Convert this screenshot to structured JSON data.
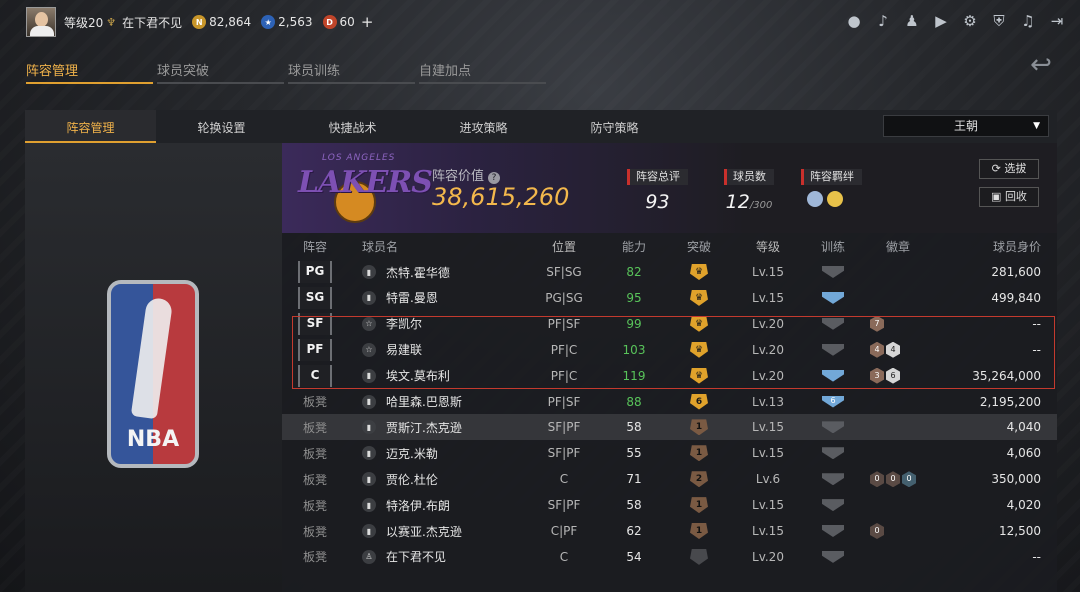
{
  "topbar": {
    "level": "等级20",
    "username": "在下君不见",
    "gold": "82,864",
    "stars": "2,563",
    "tickets": "60",
    "plus": "+"
  },
  "tabs_main": [
    "阵容管理",
    "球员突破",
    "球员训练",
    "自建加点"
  ],
  "tabs_sub": [
    "阵容管理",
    "轮换设置",
    "快捷战术",
    "进攻策略",
    "防守策略"
  ],
  "dynasty_select": "王朝",
  "team": {
    "logo_small": "LOS ANGELES",
    "logo_word": "LAKERS",
    "value_label": "阵容价值",
    "value": "38,615,260",
    "rating_label": "阵容总评",
    "rating": "93",
    "players_label": "球员数",
    "players": "12",
    "players_max": "/300",
    "bond_label": "阵容羁绊",
    "btn_select": "选拔",
    "btn_recycle": "回收"
  },
  "columns": [
    "阵容",
    "球员名",
    "位置",
    "能力",
    "突破",
    "等级",
    "训练",
    "徽章",
    "球员身价"
  ],
  "rows": [
    {
      "slot": "PG",
      "bench": false,
      "name": "杰特.霍华德",
      "pos": "SF|SG",
      "ovr": "82",
      "brk": "",
      "brkType": "gold",
      "lv": "Lv.15",
      "train": "",
      "trainType": "grey",
      "badges": [],
      "price": "281,600",
      "icon": "bars"
    },
    {
      "slot": "SG",
      "bench": false,
      "name": "特雷.曼恩",
      "pos": "PG|SG",
      "ovr": "95",
      "brk": "",
      "brkType": "gold",
      "lv": "Lv.15",
      "train": "",
      "trainType": "blue",
      "badges": [],
      "price": "499,840",
      "icon": "bars"
    },
    {
      "slot": "SF",
      "bench": false,
      "name": "李凯尔",
      "pos": "PF|SF",
      "ovr": "99",
      "brk": "",
      "brkType": "gold",
      "lv": "Lv.20",
      "train": "",
      "trainType": "grey",
      "badges": [
        {
          "t": "7",
          "c": ""
        }
      ],
      "price": "--",
      "icon": "star"
    },
    {
      "slot": "PF",
      "bench": false,
      "name": "易建联",
      "pos": "PF|C",
      "ovr": "103",
      "brk": "",
      "brkType": "gold",
      "lv": "Lv.20",
      "train": "",
      "trainType": "grey",
      "badges": [
        {
          "t": "4",
          "c": ""
        },
        {
          "t": "4",
          "c": "s"
        }
      ],
      "price": "--",
      "icon": "star"
    },
    {
      "slot": "C",
      "bench": false,
      "name": "埃文.莫布利",
      "pos": "PF|C",
      "ovr": "119",
      "brk": "",
      "brkType": "gold",
      "lv": "Lv.20",
      "train": "",
      "trainType": "blue",
      "badges": [
        {
          "t": "3",
          "c": ""
        },
        {
          "t": "6",
          "c": "s"
        }
      ],
      "price": "35,264,000",
      "icon": "bars"
    },
    {
      "slot": "板凳",
      "bench": true,
      "name": "哈里森.巴恩斯",
      "pos": "PF|SF",
      "ovr": "88",
      "brk": "6",
      "brkType": "gold",
      "lv": "Lv.13",
      "train": "6",
      "trainType": "blue",
      "badges": [],
      "price": "2,195,200",
      "icon": "bars"
    },
    {
      "slot": "板凳",
      "bench": true,
      "name": "贾斯汀.杰克逊",
      "pos": "SF|PF",
      "ovr": "58",
      "brk": "1",
      "brkType": "br",
      "lv": "Lv.15",
      "train": "",
      "trainType": "grey",
      "badges": [],
      "price": "4,040",
      "icon": "bars",
      "hl": true
    },
    {
      "slot": "板凳",
      "bench": true,
      "name": "迈克.米勒",
      "pos": "SF|PF",
      "ovr": "55",
      "brk": "1",
      "brkType": "br",
      "lv": "Lv.15",
      "train": "",
      "trainType": "grey",
      "badges": [],
      "price": "4,060",
      "icon": "bars"
    },
    {
      "slot": "板凳",
      "bench": true,
      "name": "贾伦.杜伦",
      "pos": "C",
      "ovr": "71",
      "brk": "2",
      "brkType": "br",
      "lv": "Lv.6",
      "train": "",
      "trainType": "grey",
      "badges": [
        {
          "t": "0",
          "c": "dk"
        },
        {
          "t": "0",
          "c": "dk"
        },
        {
          "t": "0",
          "c": "bl"
        }
      ],
      "price": "350,000",
      "icon": "bars"
    },
    {
      "slot": "板凳",
      "bench": true,
      "name": "特洛伊.布朗",
      "pos": "SF|PF",
      "ovr": "58",
      "brk": "1",
      "brkType": "br",
      "lv": "Lv.15",
      "train": "",
      "trainType": "grey",
      "badges": [],
      "price": "4,020",
      "icon": "bars"
    },
    {
      "slot": "板凳",
      "bench": true,
      "name": "以赛亚.杰克逊",
      "pos": "C|PF",
      "ovr": "62",
      "brk": "1",
      "brkType": "br",
      "lv": "Lv.15",
      "train": "",
      "trainType": "grey",
      "badges": [
        {
          "t": "0",
          "c": "dk"
        }
      ],
      "price": "12,500",
      "icon": "bars"
    },
    {
      "slot": "板凳",
      "bench": true,
      "name": "在下君不见",
      "pos": "C",
      "ovr": "54",
      "brk": "",
      "brkType": "grey",
      "lv": "Lv.20",
      "train": "",
      "trainType": "grey",
      "badges": [],
      "price": "--",
      "icon": "person"
    }
  ]
}
